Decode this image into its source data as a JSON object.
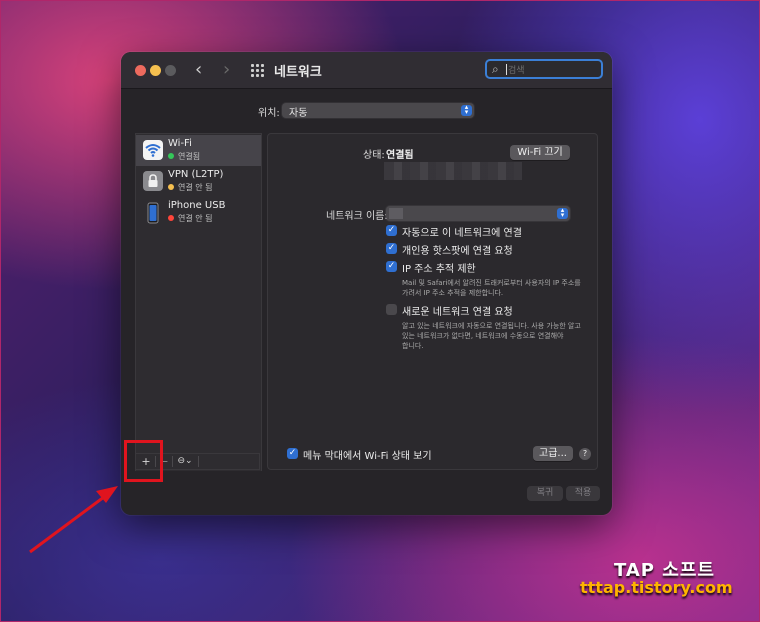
{
  "window": {
    "title": "네트워크",
    "search_placeholder": "검색"
  },
  "location": {
    "label": "위치:",
    "value": "자동"
  },
  "services": [
    {
      "name": "Wi-Fi",
      "status": "연결됨",
      "status_color": "#34c759"
    },
    {
      "name": "VPN (L2TP)",
      "status": "연결 안 됨",
      "status_color": "#f5bf4f"
    },
    {
      "name": "iPhone USB",
      "status": "연결 안 됨",
      "status_color": "#ff453a"
    }
  ],
  "toolbar": {
    "add": "+",
    "remove": "−",
    "more": "⊖⌄"
  },
  "detail": {
    "status_label": "상태:",
    "status_value": "연결됨",
    "wifi_off_button": "Wi-Fi 끄기",
    "network_name_label": "네트워크 이름:",
    "auto_join": "자동으로 이 네트워크에 연결",
    "ask_hotspot": "개인용 핫스팟에 연결 요청",
    "limit_ip": "IP 주소 추적 제한",
    "limit_ip_help_1": "Mail 및 Safari에서 알려진 트래커로부터 사용자의 IP 주소를",
    "limit_ip_help_2": "가려서 IP 주소 추적을 제한합니다.",
    "ask_new": "새로운 네트워크 연결 요청",
    "ask_new_help_1": "알고 있는 네트워크에 자동으로 연결됩니다. 사용 가능한 알고",
    "ask_new_help_2": "있는 네트워크가 없다면, 네트워크에 수동으로 연결해야",
    "ask_new_help_3": "합니다.",
    "show_menu": "메뉴 막대에서 Wi-Fi 상태 보기",
    "advanced_button": "고급...",
    "help": "?"
  },
  "footer": {
    "revert": "복귀",
    "apply": "적용"
  },
  "watermark": {
    "title": "TAP 소프트",
    "url": "tttap.tistory.com"
  },
  "colors": {
    "accent": "#2f6fd1",
    "highlight": "#e0141e"
  }
}
